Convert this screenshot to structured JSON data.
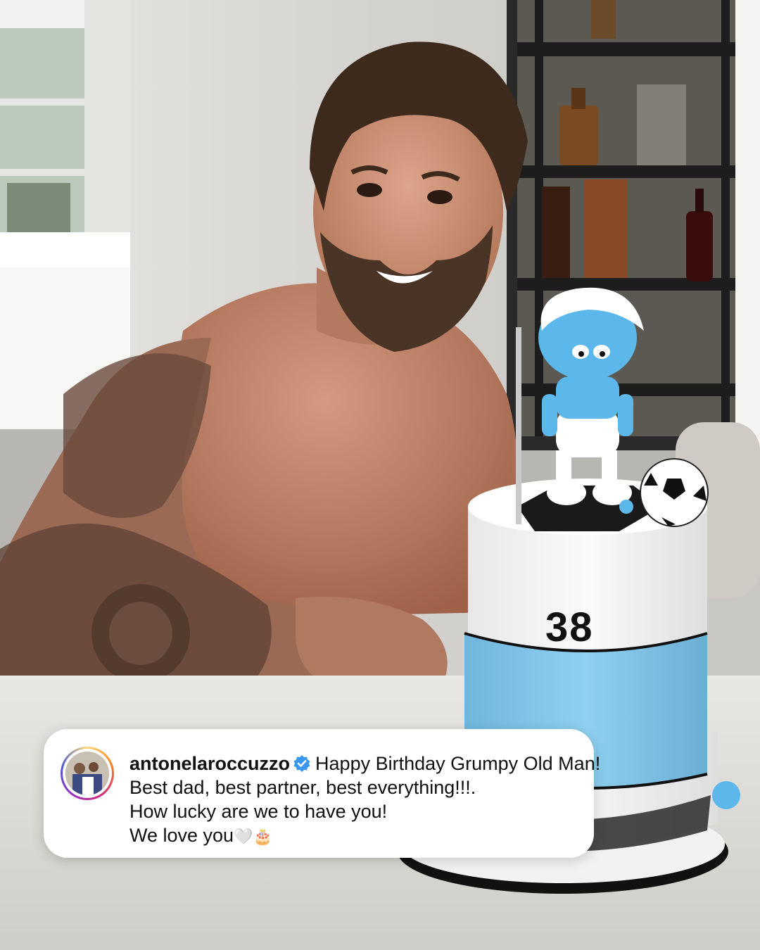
{
  "post": {
    "cake_number": "38",
    "caption": {
      "username": "antonelaroccuzzo",
      "verified_icon": "verified-badge-icon",
      "line1": "Happy Birthday Grumpy Old Man!",
      "line2": "Best dad, best partner, best everything!!!.",
      "line3": "How lucky are we to have you!",
      "line4": "We love you",
      "line4_emoji": "🤍🎂"
    }
  },
  "colors": {
    "verified_blue": "#3897f0",
    "cake_blue": "#7fc4e8",
    "smurf_blue": "#5cb8ea"
  }
}
